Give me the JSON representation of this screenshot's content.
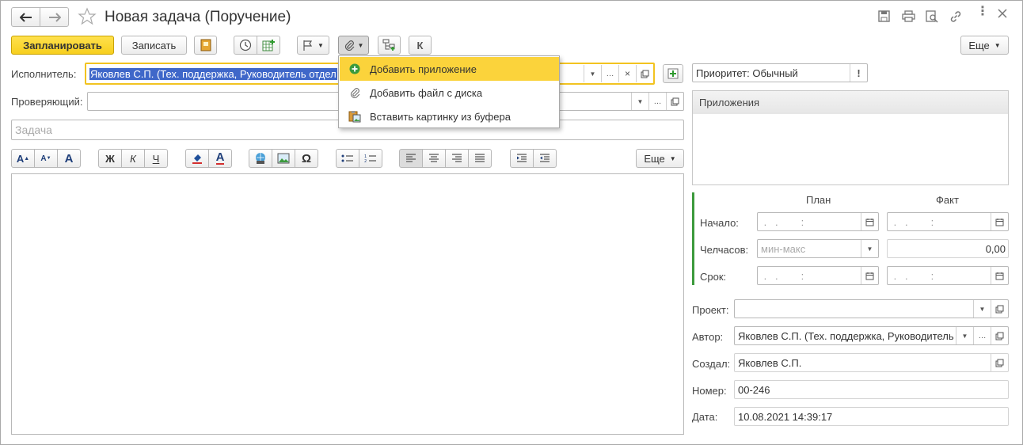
{
  "window": {
    "title": "Новая задача (Поручение)"
  },
  "toolbar": {
    "plan_label": "Запланировать",
    "save_label": "Записать",
    "k_label": "К",
    "more_label": "Еще"
  },
  "attach_menu": {
    "items": [
      {
        "label": "Добавить приложение",
        "icon": "add-circle-icon",
        "selected": true
      },
      {
        "label": "Добавить файл с диска",
        "icon": "paperclip-icon",
        "selected": false
      },
      {
        "label": "Вставить картинку из буфера",
        "icon": "paste-image-icon",
        "selected": false
      }
    ]
  },
  "form": {
    "executor_label": "Исполнитель:",
    "executor_value": "Яковлев С.П. (Тех. поддержка, Руководитель отдел",
    "reviewer_label": "Проверяющий:",
    "reviewer_value": "",
    "task_placeholder": "Задача",
    "priority_value": "Приоритет: Обычный"
  },
  "format_toolbar": {
    "bold": "Ж",
    "italic": "К",
    "underline": "Ч",
    "omega": "Ω",
    "more_label": "Еще"
  },
  "attachments": {
    "header": "Приложения"
  },
  "schedule": {
    "plan_header": "План",
    "fact_header": "Факт",
    "start_label": "Начало:",
    "hours_label": "Челчасов:",
    "deadline_label": "Срок:",
    "date_mask": " .   .        :",
    "hours_placeholder": "мин-макс",
    "hours_fact": "0,00"
  },
  "details": {
    "project_label": "Проект:",
    "project_value": "",
    "author_label": "Автор:",
    "author_value": "Яковлев С.П. (Тех. поддержка, Руководитель",
    "created_label": "Создал:",
    "created_value": "Яковлев С.П.",
    "number_label": "Номер:",
    "number_value": "00-246",
    "date_label": "Дата:",
    "date_value": "10.08.2021 14:39:17"
  },
  "colors": {
    "primary": "#f7cf1e",
    "selection": "#3f67c9",
    "menu_highlight": "#fbd33b",
    "schedule_accent": "#3c9a3c"
  }
}
